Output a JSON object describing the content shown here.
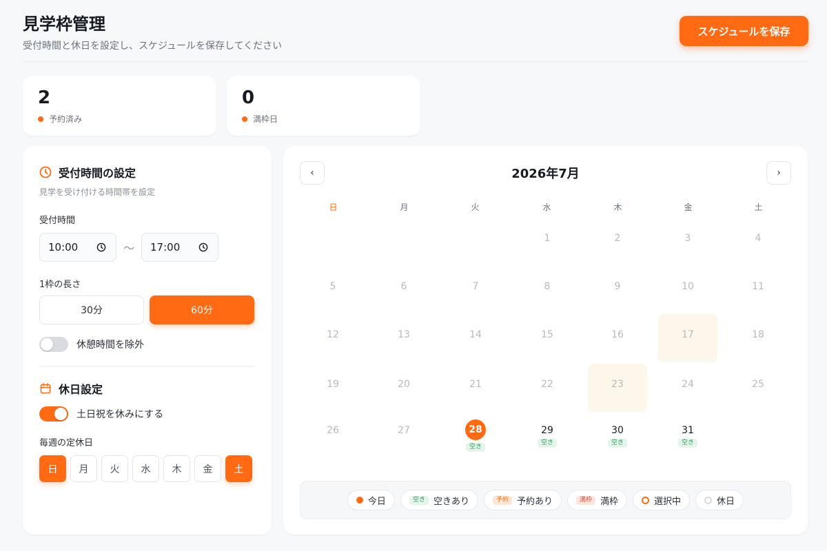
{
  "header": {
    "title": "見学枠管理",
    "subtitle": "受付時間と休日を設定し、スケジュールを保存してください",
    "save_label": "スケジュールを保存"
  },
  "stats": [
    {
      "value": "2",
      "label": "予約済み"
    },
    {
      "value": "0",
      "label": "満枠日"
    }
  ],
  "reception": {
    "title": "受付時間の設定",
    "subtitle": "見学を受け付ける時間帯を設定",
    "time_label": "受付時間",
    "start": "10:00",
    "separator": "〜",
    "end": "17:00",
    "slot_label": "1枠の長さ",
    "slot_options": [
      "30分",
      "60分"
    ],
    "slot_selected": "60分",
    "break_toggle_label": "休憩時間を除外",
    "break_toggle_on": false
  },
  "holidays": {
    "title": "休日設定",
    "weekend_toggle_label": "土日祝を休みにする",
    "weekend_toggle_on": true,
    "weekly_label": "毎週の定休日",
    "weekdays": [
      "日",
      "月",
      "火",
      "水",
      "木",
      "金",
      "土"
    ],
    "weekdays_selected": [
      "日",
      "土"
    ]
  },
  "calendar": {
    "month_title": "2026年7月",
    "prev_label": "‹",
    "next_label": "›",
    "dow": [
      "日",
      "月",
      "火",
      "水",
      "木",
      "金",
      "土"
    ],
    "days": [
      {
        "num": "1"
      },
      {
        "num": "2"
      },
      {
        "num": "3"
      },
      {
        "num": "4"
      },
      {
        "num": "5"
      },
      {
        "num": "6"
      },
      {
        "num": "7"
      },
      {
        "num": "8"
      },
      {
        "num": "9"
      },
      {
        "num": "10"
      },
      {
        "num": "11"
      },
      {
        "num": "12"
      },
      {
        "num": "13"
      },
      {
        "num": "14"
      },
      {
        "num": "15"
      },
      {
        "num": "16"
      },
      {
        "num": "17",
        "highlight": true
      },
      {
        "num": "18"
      },
      {
        "num": "19"
      },
      {
        "num": "20"
      },
      {
        "num": "21"
      },
      {
        "num": "22"
      },
      {
        "num": "23",
        "highlight": true
      },
      {
        "num": "24"
      },
      {
        "num": "25"
      },
      {
        "num": "26"
      },
      {
        "num": "27"
      },
      {
        "num": "28",
        "today": true,
        "badge": "空き"
      },
      {
        "num": "29",
        "badge": "空き"
      },
      {
        "num": "30",
        "badge": "空き"
      },
      {
        "num": "31",
        "badge": "空き"
      }
    ]
  },
  "legend": {
    "today": "今日",
    "free_tag": "空き",
    "free": "空きあり",
    "reserved_tag": "予約",
    "reserved": "予約あり",
    "full_tag": "満枠",
    "full": "満枠",
    "selected": "選択中",
    "holiday": "休日"
  },
  "colors": {
    "accent": "#ff6a13",
    "free": "#2f9a5b",
    "highlight_bg": "#fdf6ea"
  }
}
